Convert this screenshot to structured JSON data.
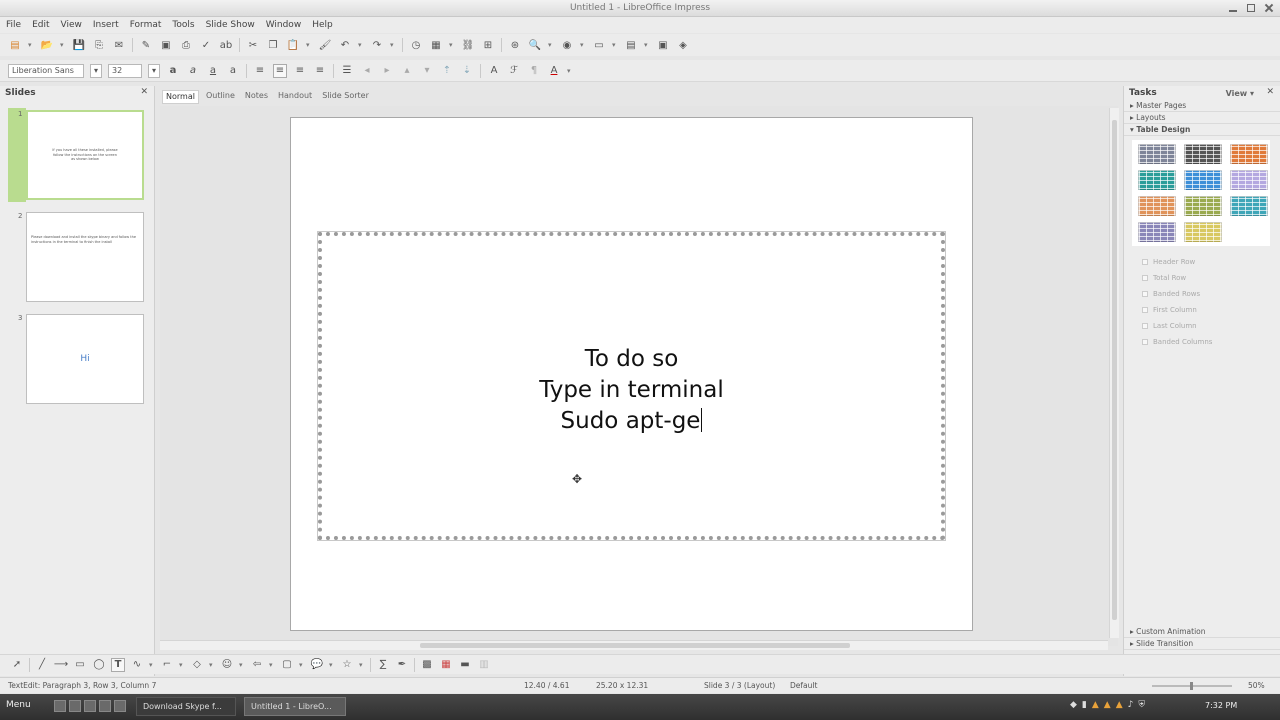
{
  "window": {
    "title": "Untitled 1 - LibreOffice Impress"
  },
  "menu": [
    "File",
    "Edit",
    "View",
    "Insert",
    "Format",
    "Tools",
    "Slide Show",
    "Window",
    "Help"
  ],
  "formatting": {
    "font_name": "Liberation Sans",
    "font_size": "32"
  },
  "slides_panel": {
    "title": "Slides",
    "thumbnails": [
      {
        "number": "1",
        "text": "If you have all these installed, please follow the instructions on the screen as shown below"
      },
      {
        "number": "2",
        "text": "Please download and install the skype binary and follow the instructions in the terminal to finish the install"
      },
      {
        "number": "3",
        "text": "Hi"
      }
    ]
  },
  "view_tabs": [
    "Normal",
    "Outline",
    "Notes",
    "Handout",
    "Slide Sorter"
  ],
  "slide": {
    "lines": [
      "To do so",
      "Type in terminal",
      "Sudo apt-ge"
    ]
  },
  "tasks_panel": {
    "title": "Tasks",
    "view_label": "View",
    "sections_top": [
      "Master Pages",
      "Layouts",
      "Table Design"
    ],
    "design_colors": [
      "#7f8599",
      "#555555",
      "#e07a3a",
      "#2a9d9a",
      "#3d8fd8",
      "#b4a8e0",
      "#e0935a",
      "#9aaa4e",
      "#3fa6b8",
      "#8a86b8",
      "#d8c860"
    ],
    "options": [
      "Header Row",
      "Total Row",
      "Banded Rows",
      "First Column",
      "Last Column",
      "Banded Columns"
    ],
    "sections_bottom": [
      "Custom Animation",
      "Slide Transition"
    ]
  },
  "status": {
    "left": "TextEdit: Paragraph 3, Row 3, Column 7",
    "position": "12.40 / 4.61",
    "size": "25.20 x 12.31",
    "slide_info": "Slide 3 / 3 (Layout)",
    "layout": "Default",
    "zoom": "50%"
  },
  "taskbar": {
    "start_label": "Menu",
    "windows": [
      {
        "label": "Download Skype f...",
        "active": false
      },
      {
        "label": "Untitled 1 - LibreO...",
        "active": true
      }
    ],
    "clock": "7:32 PM"
  }
}
